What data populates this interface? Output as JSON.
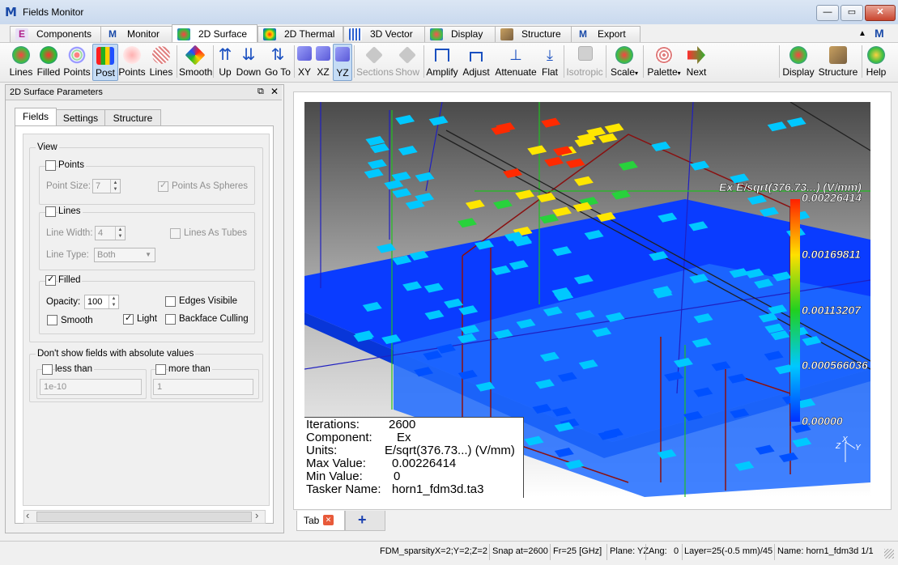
{
  "window": {
    "title": "Fields Monitor",
    "logo": "M",
    "min_label": "—",
    "max_label": "▭",
    "close_label": "✕"
  },
  "top_tabs": [
    {
      "label": "Components",
      "icon": "components-icon"
    },
    {
      "label": "Monitor",
      "icon": "monitor-icon"
    },
    {
      "label": "2D Surface",
      "icon": "surface-icon",
      "active": true
    },
    {
      "label": "2D Thermal",
      "icon": "thermal-icon"
    },
    {
      "label": "3D Vector",
      "icon": "vector-icon"
    },
    {
      "label": "Display",
      "icon": "display-icon"
    },
    {
      "label": "Structure",
      "icon": "structure-icon"
    },
    {
      "label": "Export",
      "icon": "export-icon"
    }
  ],
  "tabstrip_arrow": "▲",
  "toolbar": {
    "lines": "Lines",
    "filled": "Filled",
    "points": "Points",
    "post": "Post",
    "points2": "Points",
    "lines2": "Lines",
    "smooth": "Smooth",
    "up": "Up",
    "down": "Down",
    "goto": "Go To",
    "xy": "XY",
    "xz": "XZ",
    "yz": "YZ",
    "sections": "Sections",
    "show": "Show",
    "amplify": "Amplify",
    "adjust": "Adjust",
    "attenuate": "Attenuate",
    "flat": "Flat",
    "isotropic": "Isotropic",
    "scale": "Scale",
    "palette": "Palette",
    "next": "Next",
    "display": "Display",
    "structure": "Structure",
    "help": "Help",
    "dropdown_arrow": "▾"
  },
  "panel": {
    "title": "2D Surface Parameters",
    "float_icon": "⧉",
    "close_icon": "✕",
    "tabs": [
      "Fields",
      "Settings",
      "Structure"
    ],
    "view_label": "View",
    "points": {
      "label": "Points",
      "checked": false,
      "size_label": "Point Size:",
      "size_value": "7",
      "spheres_label": "Points As Spheres",
      "spheres_checked": true
    },
    "lines": {
      "label": "Lines",
      "checked": false,
      "width_label": "Line Width:",
      "width_value": "4",
      "tubes_label": "Lines As Tubes",
      "type_label": "Line Type:",
      "type_value": "Both"
    },
    "filled": {
      "label": "Filled",
      "checked": true,
      "opacity_label": "Opacity:",
      "opacity_value": "100",
      "edges_label": "Edges Visibile",
      "smooth_label": "Smooth",
      "light_label": "Light",
      "light_checked": true,
      "backface_label": "Backface Culling"
    },
    "threshold": {
      "title": "Don't show fields with absolute values",
      "less_label": "less than",
      "less_value": "1e-10",
      "more_label": "more than",
      "more_value": "1"
    },
    "scroll_left": "‹",
    "scroll_right": "›"
  },
  "viewport": {
    "legend_title": "Ex E/sqrt(376.73...) (V/mm)",
    "legend_ticks": [
      "0.00226414",
      "0.00169811",
      "0.00113207",
      "0.000566036",
      "0.00000"
    ],
    "axes": [
      "Z",
      "X",
      "Y"
    ],
    "info": [
      {
        "label": "Iterations:",
        "value": "2600"
      },
      {
        "label": "Component:",
        "value": "Ex"
      },
      {
        "label": "Units:",
        "value": "E/sqrt(376.73...) (V/mm)"
      },
      {
        "label": "Max Value:",
        "value": "0.00226414"
      },
      {
        "label": "Min Value:",
        "value": "0"
      },
      {
        "label": "Tasker Name:",
        "value": "horn1_fdm3d.ta3"
      }
    ],
    "colors": {
      "min": "#0050ff",
      "mid_low": "#00c8ff",
      "mid": "#28d23c",
      "mid_high": "#ffe600",
      "max": "#ff2a00"
    }
  },
  "bottom_tabs": {
    "tab_label": "Tab",
    "close_icon": "✕",
    "add_icon": "+"
  },
  "status": [
    "FDM_sparsityX=2;Y=2;Z=2",
    "Snap at=2600",
    "Fr=25 [GHz]",
    "Plane: YZ",
    "Ang:",
    "0",
    "Layer=25(-0.5 mm)/45",
    "Name: horn1_fdm3d 1/1"
  ]
}
